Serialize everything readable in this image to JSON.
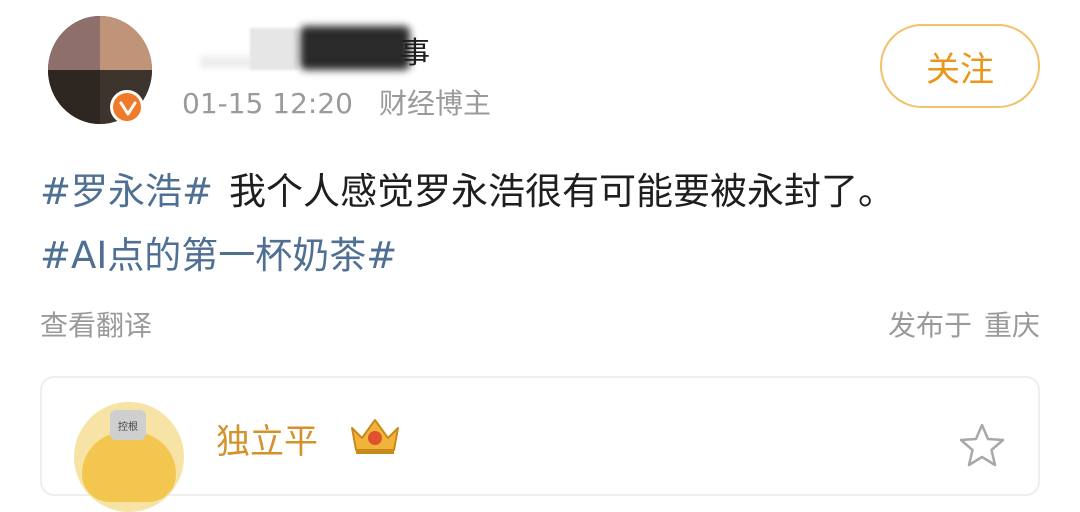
{
  "header": {
    "username_visible": "事",
    "timestamp": "01-15 12:20",
    "source": "财经博主",
    "follow_label": "关注",
    "verified_color": "#f07a2a"
  },
  "post": {
    "hashtag1": "#罗永浩#",
    "text": "我个人感觉罗永浩很有可能要被永封了。",
    "hashtag2": "#AI点的第一杯奶茶#",
    "hashtag_color": "#4f6f93"
  },
  "footer": {
    "translate_label": "查看翻译",
    "location_prefix": "发布于",
    "location_place": "重庆"
  },
  "comment": {
    "username": "独立平",
    "avatar_label": "控根",
    "name_color": "#d4922a",
    "badge_icon": "crown-icon",
    "action_icon": "star-icon"
  }
}
